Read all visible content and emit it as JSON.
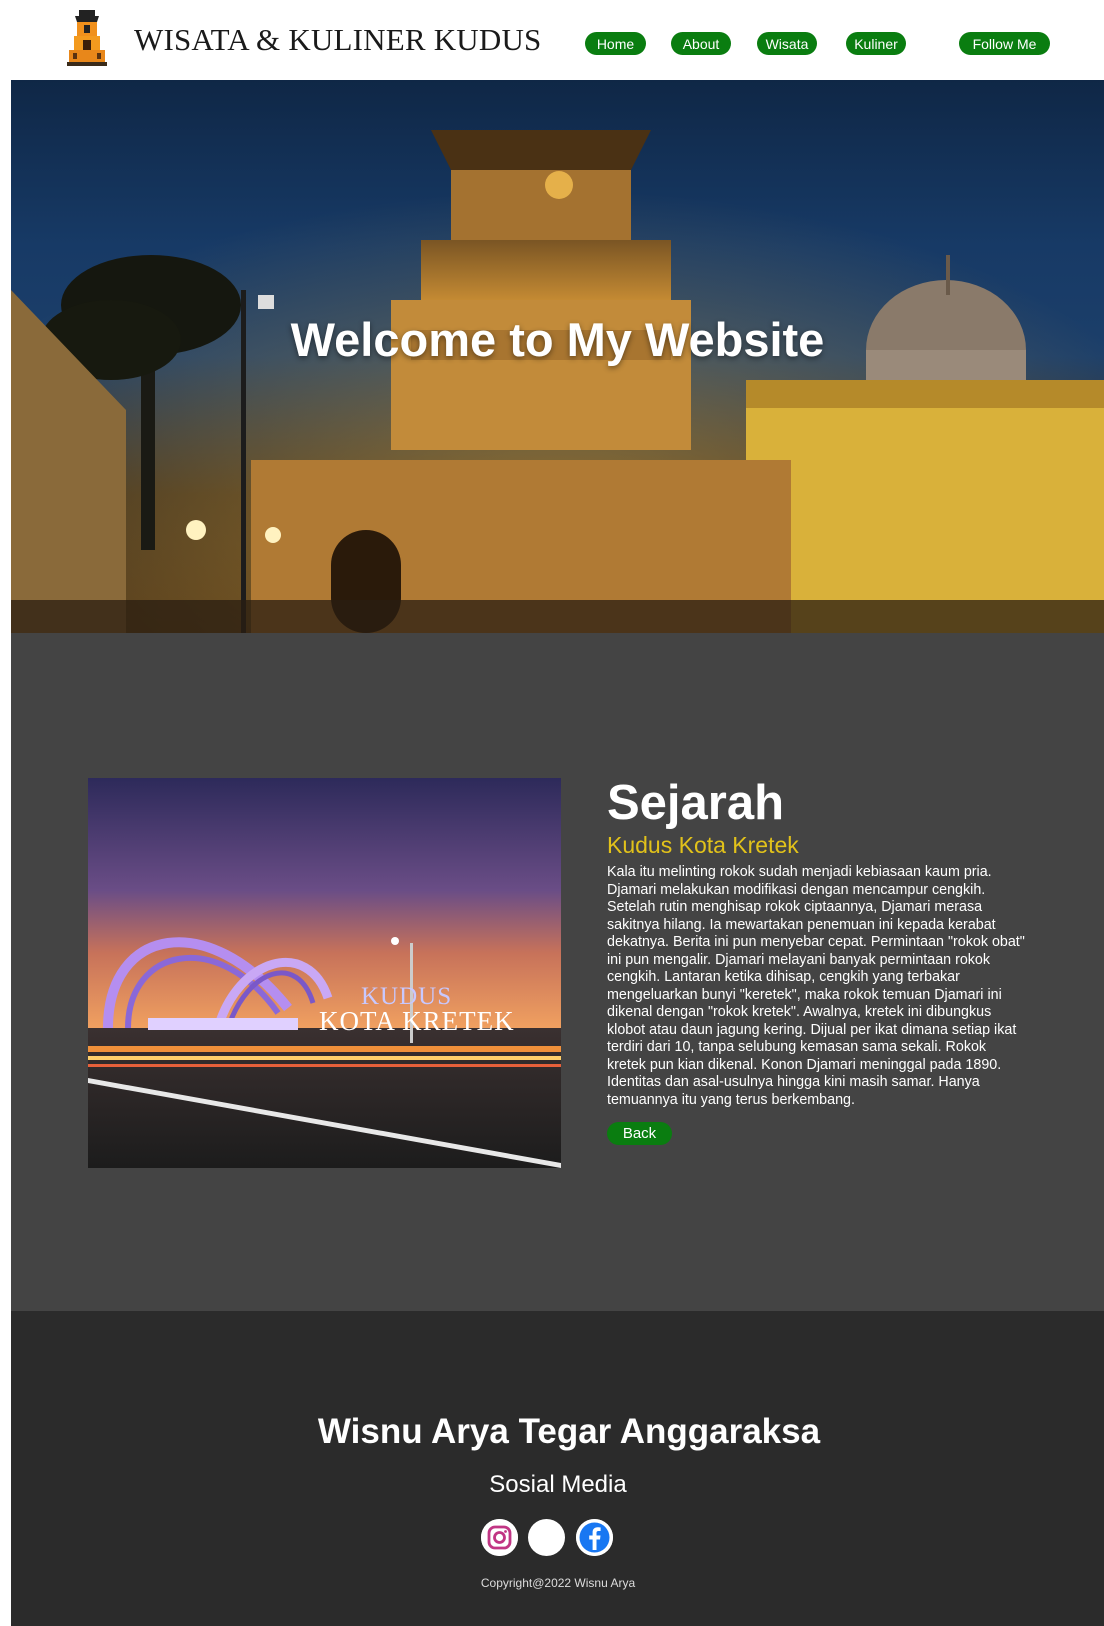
{
  "navbar": {
    "brand": "WISATA & KULINER KUDUS",
    "logo_icon": "menara-kudus-logo-icon",
    "links": {
      "home": "Home",
      "about": "About",
      "wisata": "Wisata",
      "kuliner": "Kuliner",
      "follow": "Follow Me"
    },
    "accent_color": "#0a7d10"
  },
  "hero": {
    "title": "Welcome to My Website",
    "image": "menara-kudus-night-photo"
  },
  "about": {
    "heading": "Sejarah",
    "subheading": "Kudus Kota Kretek",
    "body": "Kala itu melinting rokok sudah menjadi kebiasaan kaum pria. Djamari melakukan modifikasi dengan mencampur cengkih. Setelah rutin menghisap rokok ciptaannya, Djamari merasa sakitnya hilang. Ia mewartakan penemuan ini kepada kerabat dekatnya. Berita ini pun menyebar cepat. Permintaan \"rokok obat\" ini pun mengalir. Djamari melayani banyak permintaan rokok cengkih. Lantaran ketika dihisap, cengkih yang terbakar mengeluarkan bunyi \"keretek\", maka rokok temuan Djamari ini dikenal dengan \"rokok kretek\". Awalnya, kretek ini dibungkus klobot atau daun jagung kering. Dijual per ikat dimana setiap ikat terdiri dari 10, tanpa selubung kemasan sama sekali. Rokok kretek pun kian dikenal. Konon Djamari meninggal pada 1890. Identitas dan asal-usulnya hingga kini masih samar. Hanya temuannya itu yang terus berkembang.",
    "back_label": "Back",
    "image": "kudus-kota-kretek-monument-photo",
    "monument_text_1": "KUDUS",
    "monument_text_2": "KOTA KRETEK",
    "subheading_color": "#e2c21a"
  },
  "footer": {
    "name": "Wisnu Arya Tegar Anggaraksa",
    "social_title": "Sosial Media",
    "social_icons": [
      "instagram-icon",
      "twitter-icon",
      "facebook-icon"
    ],
    "copyright": "Copyright@2022 Wisnu Arya"
  }
}
